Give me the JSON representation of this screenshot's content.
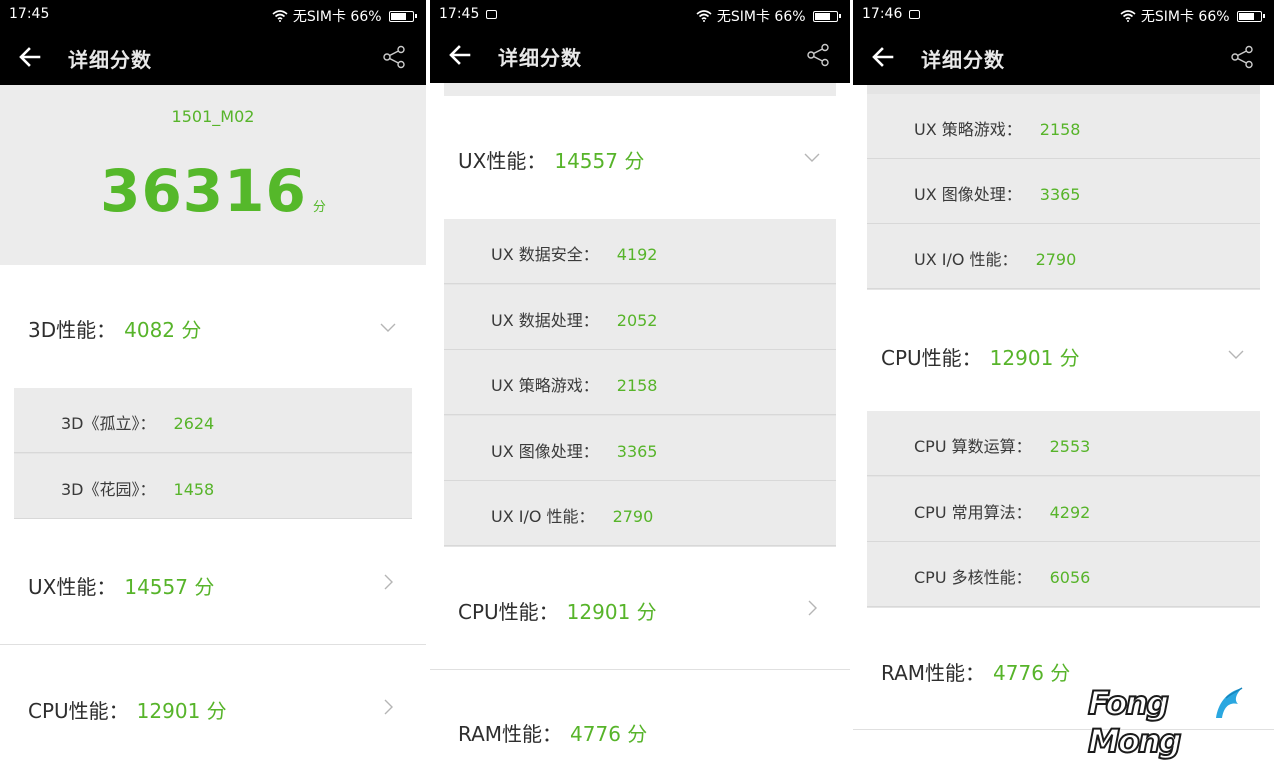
{
  "status": {
    "times": [
      "17:45",
      "17:45",
      "17:46"
    ],
    "carrier": "无SIM卡",
    "battery": "66%"
  },
  "toolbar": {
    "title": "详细分数"
  },
  "hero": {
    "model": "1501_M02",
    "score": "36316",
    "unit": "分"
  },
  "categories": {
    "d3": {
      "label": "3D性能：",
      "value": "4082 分"
    },
    "ux": {
      "label": "UX性能：",
      "value": "14557 分"
    },
    "cpu": {
      "label": "CPU性能：",
      "value": "12901 分"
    },
    "ram": {
      "label": "RAM性能：",
      "value": "4776 分"
    }
  },
  "sub_3d": [
    {
      "label": "3D《孤立》：",
      "value": "2624"
    },
    {
      "label": "3D《花园》：",
      "value": "1458"
    }
  ],
  "sub_ux": [
    {
      "label": "UX 数据安全：",
      "value": "4192"
    },
    {
      "label": "UX 数据处理：",
      "value": "2052"
    },
    {
      "label": "UX 策略游戏：",
      "value": "2158"
    },
    {
      "label": "UX 图像处理：",
      "value": "3365"
    },
    {
      "label": "UX I/O 性能：",
      "value": "2790"
    }
  ],
  "sub_cpu": [
    {
      "label": "CPU 算数运算：",
      "value": "2553"
    },
    {
      "label": "CPU 常用算法：",
      "value": "4292"
    },
    {
      "label": "CPU 多核性能：",
      "value": "6056"
    }
  ],
  "watermark": {
    "text": "Fong Mong"
  },
  "icons": {
    "back": "arrow-left-icon",
    "share": "share-icon",
    "chevron_down": "chevron-down-icon",
    "chevron_right": "chevron-right-icon"
  },
  "colors": {
    "accent": "#57b42a",
    "toolbar": "#000000",
    "hero_bg": "#ececec",
    "sub_bg": "#ebebeb"
  }
}
